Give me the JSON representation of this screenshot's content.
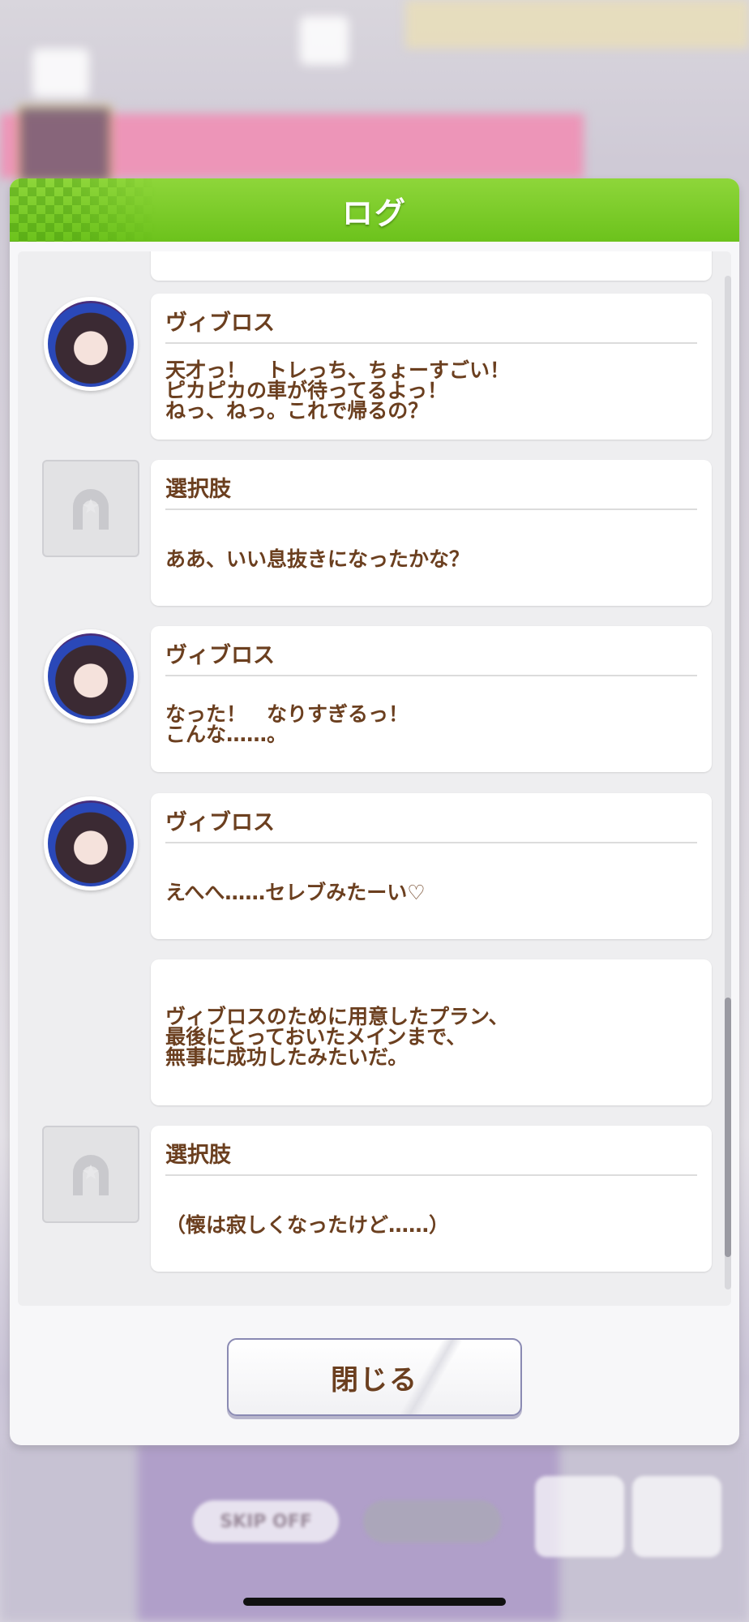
{
  "background": {
    "pink_banner_text": "",
    "bottom_controls": {
      "skip_label": "SKIP OFF",
      "auto_label": ""
    }
  },
  "log_panel": {
    "title": "ログ",
    "entries": [
      {
        "type": "character",
        "speaker": "",
        "text": ""
      },
      {
        "type": "character",
        "speaker": "ヴィブロス",
        "text": "天才っ！　トレっち、ちょーすごい！\nピカピカの車が待ってるよっ！\nねっ、ねっ。これで帰るの？"
      },
      {
        "type": "choice",
        "speaker": "選択肢",
        "text": "ああ、いい息抜きになったかな？"
      },
      {
        "type": "character",
        "speaker": "ヴィブロス",
        "text": "なった！　なりすぎるっ！\nこんな……。"
      },
      {
        "type": "character",
        "speaker": "ヴィブロス",
        "text": "えへへ……セレブみたーい♡"
      },
      {
        "type": "narration",
        "speaker": "",
        "text": "ヴィブロスのために用意したプラン、\n最後にとっておいたメインまで、\n無事に成功したみたいだ。"
      },
      {
        "type": "choice",
        "speaker": "選択肢",
        "text": "（懐は寂しくなったけど……）"
      }
    ],
    "close_label": "閉じる"
  },
  "colors": {
    "header_green": "#7ccc2a",
    "text_brown": "#6b3f1f"
  }
}
